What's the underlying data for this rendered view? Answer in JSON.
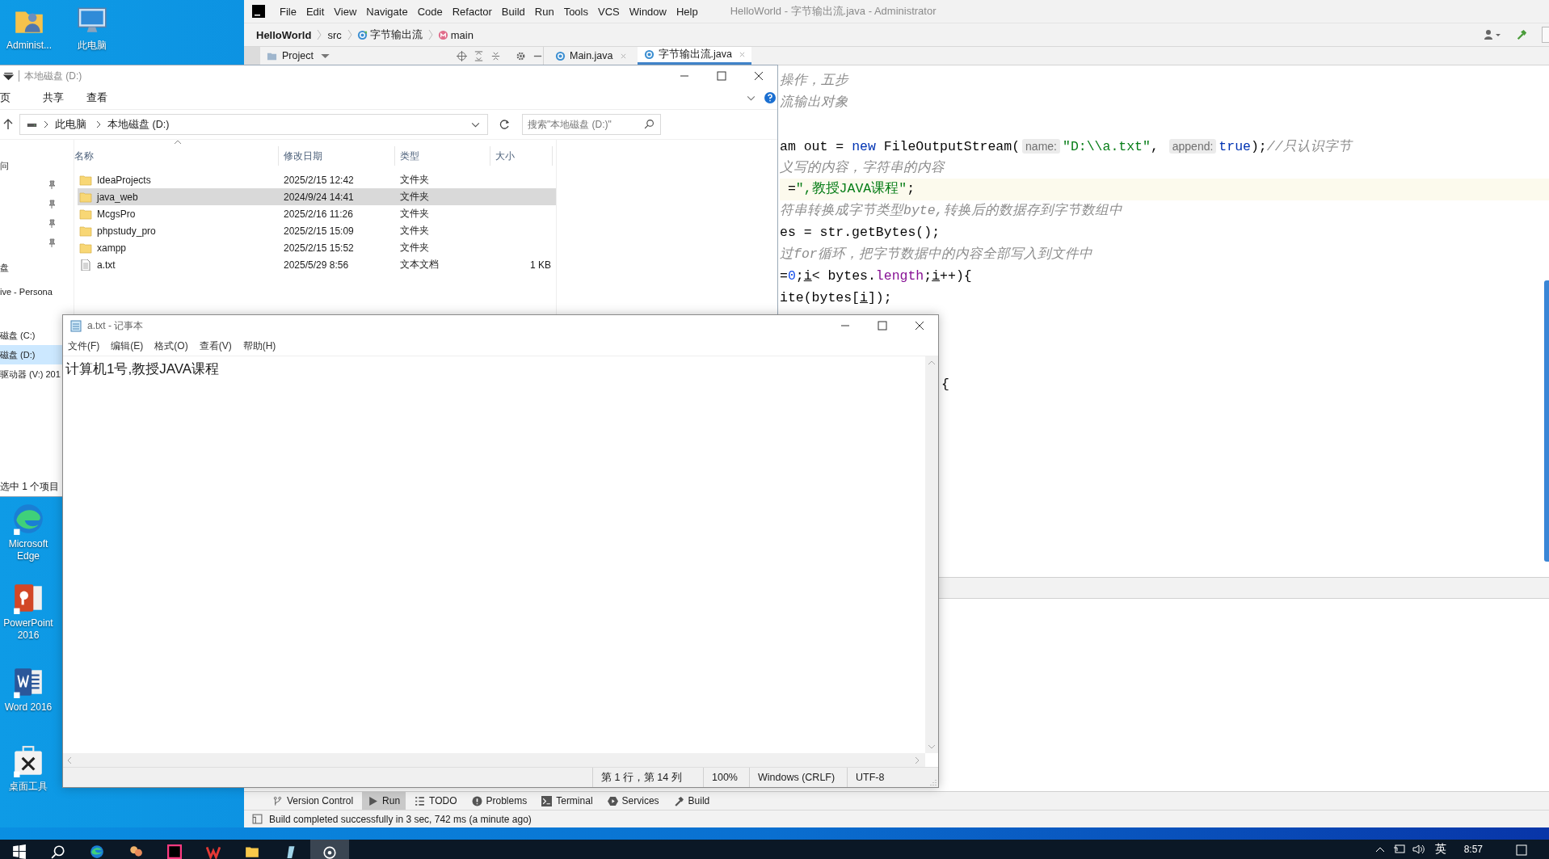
{
  "desktop": {
    "top_icons": [
      {
        "label": "Administ...",
        "kind": "user-folder"
      },
      {
        "label": "此电脑",
        "kind": "computer"
      }
    ],
    "side_icons": [
      {
        "label": "Microsoft Edge",
        "kind": "edge"
      },
      {
        "label": "PowerPoint 2016",
        "kind": "powerpoint"
      },
      {
        "label": "Word 2016",
        "kind": "word"
      },
      {
        "label": "桌面工具",
        "kind": "toolbox"
      }
    ]
  },
  "ide": {
    "window_title": "HelloWorld - 字节输出流.java - Administrator",
    "menu": [
      "File",
      "Edit",
      "View",
      "Navigate",
      "Code",
      "Refactor",
      "Build",
      "Run",
      "Tools",
      "VCS",
      "Window",
      "Help"
    ],
    "breadcrumb": [
      {
        "label": "HelloWorld",
        "kind": "project"
      },
      {
        "label": "src",
        "kind": "folder"
      },
      {
        "label": "字节输出流",
        "kind": "class"
      },
      {
        "label": "main",
        "kind": "method"
      }
    ],
    "tool_window": "Project",
    "tabs": [
      {
        "label": "Main.java",
        "selected": false
      },
      {
        "label": "字节输出流.java",
        "selected": true
      }
    ],
    "code_lines": [
      {
        "current": false,
        "segments": [
          {
            "text": "操作，五步",
            "kind": "comment"
          }
        ]
      },
      {
        "current": false,
        "segments": [
          {
            "text": "流输出对象",
            "kind": "comment"
          }
        ]
      },
      {
        "current": false,
        "segments": [
          {
            "text": "am out = ",
            "kind": "plain"
          },
          {
            "text": "new",
            "kind": "keyword"
          },
          {
            "text": " FileOutputStream(",
            "kind": "plain"
          },
          {
            "text": "name:",
            "kind": "hint"
          },
          {
            "text": "\"D:\\\\a.txt\"",
            "kind": "string"
          },
          {
            "text": ", ",
            "kind": "plain"
          },
          {
            "text": "append:",
            "kind": "hint"
          },
          {
            "text": "true",
            "kind": "keyword"
          },
          {
            "text": ");",
            "kind": "plain"
          },
          {
            "text": "//只认识字节",
            "kind": "comment"
          }
        ]
      },
      {
        "current": false,
        "segments": [
          {
            "text": "义写的内容，字符串的内容",
            "kind": "comment"
          }
        ]
      },
      {
        "current": true,
        "segments": [
          {
            "text": " =",
            "kind": "plain"
          },
          {
            "text": "\",教授JAVA课程\"",
            "kind": "string"
          },
          {
            "text": ";",
            "kind": "plain"
          }
        ]
      },
      {
        "current": false,
        "segments": [
          {
            "text": "符串转换成字节类型byte,转换后的数据存到字节数组中",
            "kind": "comment"
          }
        ]
      },
      {
        "current": false,
        "segments": [
          {
            "text": "es = str.getBytes();",
            "kind": "plain"
          }
        ]
      },
      {
        "current": false,
        "segments": [
          {
            "text": "过for循环，把字节数据中的内容全部写入到文件中",
            "kind": "comment"
          }
        ]
      },
      {
        "current": false,
        "segments": [
          {
            "text": "=",
            "kind": "plain"
          },
          {
            "text": "0",
            "kind": "number"
          },
          {
            "text": ";",
            "kind": "plain"
          },
          {
            "text": "i",
            "kind": "var"
          },
          {
            "text": "< bytes.",
            "kind": "plain"
          },
          {
            "text": "length",
            "kind": "field"
          },
          {
            "text": ";",
            "kind": "plain"
          },
          {
            "text": "i",
            "kind": "var"
          },
          {
            "text": "++){",
            "kind": "plain"
          }
        ]
      },
      {
        "current": false,
        "segments": [
          {
            "text": "ite(bytes[",
            "kind": "plain"
          },
          {
            "text": "i",
            "kind": "var"
          },
          {
            "text": "]);",
            "kind": "plain"
          }
        ]
      },
      {
        "current": false,
        "behind_notepad": true,
        "segments": [
          {
            "text": "{",
            "kind": "plain"
          }
        ]
      }
    ],
    "bottom_tools": [
      {
        "label": "Version Control",
        "kind": "vcs",
        "selected": false
      },
      {
        "label": "Run",
        "kind": "run",
        "selected": true
      },
      {
        "label": "TODO",
        "kind": "todo",
        "selected": false
      },
      {
        "label": "Problems",
        "kind": "problems",
        "selected": false
      },
      {
        "label": "Terminal",
        "kind": "terminal",
        "selected": false
      },
      {
        "label": "Services",
        "kind": "services",
        "selected": false
      },
      {
        "label": "Build",
        "kind": "build",
        "selected": false
      }
    ],
    "status": "Build completed successfully in 3 sec, 742 ms (a minute ago)"
  },
  "explorer": {
    "title": "本地磁盘 (D:)",
    "ribbon_tabs": [
      "页",
      "共享",
      "查看"
    ],
    "path": [
      "此电脑",
      "本地磁盘 (D:)"
    ],
    "search_placeholder": "搜索\"本地磁盘 (D:)\"",
    "columns": [
      "名称",
      "修改日期",
      "类型",
      "大小"
    ],
    "files": [
      {
        "name": "IdeaProjects",
        "date": "2025/2/15 12:42",
        "type": "文件夹",
        "kind": "folder",
        "selected": false
      },
      {
        "name": "java_web",
        "date": "2024/9/24 14:41",
        "type": "文件夹",
        "kind": "folder",
        "selected": true
      },
      {
        "name": "McgsPro",
        "date": "2025/2/16 11:26",
        "type": "文件夹",
        "kind": "folder",
        "selected": false
      },
      {
        "name": "phpstudy_pro",
        "date": "2025/2/15 15:09",
        "type": "文件夹",
        "kind": "folder",
        "selected": false
      },
      {
        "name": "xampp",
        "date": "2025/2/15 15:52",
        "type": "文件夹",
        "kind": "folder",
        "selected": false
      },
      {
        "name": "a.txt",
        "date": "2025/5/29 8:56",
        "type": "文本文档",
        "size": "1 KB",
        "kind": "file",
        "selected": false
      }
    ],
    "nav_items": [
      {
        "label": "问",
        "kind": "group",
        "pinned": false,
        "selected": false
      },
      {
        "kind": "item",
        "pinned": true
      },
      {
        "kind": "item",
        "pinned": true
      },
      {
        "kind": "item",
        "pinned": true
      },
      {
        "kind": "item",
        "pinned": true
      },
      {
        "label": "盘",
        "kind": "group",
        "pinned": false,
        "selected": false
      },
      {
        "label": "ive - Persona",
        "kind": "group",
        "pinned": false,
        "selected": false
      },
      {
        "label": "磁盘 (C:)",
        "kind": "section",
        "pinned": false,
        "selected": false
      },
      {
        "label": "磁盘 (D:)",
        "kind": "item",
        "pinned": false,
        "selected": true
      },
      {
        "label": "驱动器 (V:) 201",
        "kind": "item",
        "pinned": false,
        "selected": false
      }
    ],
    "status": "选中 1 个项目"
  },
  "notepad": {
    "title": "a.txt - 记事本",
    "menu": [
      "文件(F)",
      "编辑(E)",
      "格式(O)",
      "查看(V)",
      "帮助(H)"
    ],
    "text": "计算机1号,教授JAVA课程",
    "status": [
      "第 1 行，第 14 列",
      "100%",
      "Windows (CRLF)",
      "UTF-8"
    ]
  },
  "taskbar": {
    "apps": [
      {
        "kind": "start",
        "selected": false
      },
      {
        "kind": "search",
        "selected": false
      },
      {
        "kind": "edge",
        "selected": false
      },
      {
        "kind": "app",
        "selected": false
      },
      {
        "kind": "intellij",
        "selected": false
      },
      {
        "kind": "wps",
        "selected": false
      },
      {
        "kind": "folder",
        "selected": false
      },
      {
        "kind": "pen",
        "selected": false
      },
      {
        "kind": "capture",
        "selected": true
      }
    ],
    "ime": "英",
    "time": "8:57"
  }
}
